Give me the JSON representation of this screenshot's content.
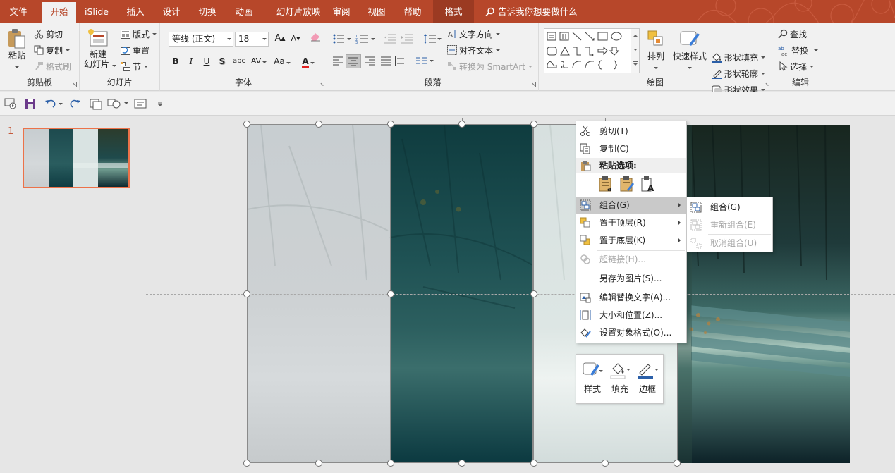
{
  "tabs": [
    {
      "label": "文件"
    },
    {
      "label": "开始"
    },
    {
      "label": "iSlide"
    },
    {
      "label": "插入"
    },
    {
      "label": "设计"
    },
    {
      "label": "切换"
    },
    {
      "label": "动画"
    },
    {
      "label": "幻灯片放映"
    },
    {
      "label": "审阅"
    },
    {
      "label": "视图"
    },
    {
      "label": "帮助"
    },
    {
      "label": "格式"
    }
  ],
  "tell_me": "告诉我你想要做什么",
  "ribbon": {
    "clipboard": {
      "label": "剪贴板",
      "paste": "粘贴",
      "cut": "剪切",
      "copy": "复制",
      "format_painter": "格式刷"
    },
    "slides": {
      "label": "幻灯片",
      "new_slide_line1": "新建",
      "new_slide_line2": "幻灯片",
      "layout": "版式",
      "reset": "重置",
      "section": "节"
    },
    "font": {
      "label": "字体",
      "font_name": "等线 (正文)",
      "font_size": "18",
      "grow": "A",
      "shrink": "A",
      "bold": "B",
      "italic": "I",
      "underline": "U",
      "shadow": "S",
      "strike": "abc",
      "spacing": "AV",
      "case": "Aa",
      "color": "A",
      "color_hex": "#e02020"
    },
    "paragraph": {
      "label": "段落",
      "text_direction": "文字方向",
      "align_text": "对齐文本",
      "smartart": "转换为 SmartArt"
    },
    "drawing": {
      "label": "绘图",
      "arrange": "排列",
      "quick_styles": "快速样式",
      "shape_fill": "形状填充",
      "shape_outline": "形状轮廓",
      "shape_effects": "形状效果"
    },
    "editing": {
      "label": "编辑",
      "find": "查找",
      "replace": "替换",
      "select": "选择"
    }
  },
  "thumbnail": {
    "number": "1"
  },
  "context_menu": {
    "cut": "剪切(T)",
    "copy": "复制(C)",
    "paste_options": "粘贴选项:",
    "group": "组合(G)",
    "bring_front": "置于顶层(R)",
    "send_back": "置于底层(K)",
    "hyperlink": "超链接(H)...",
    "save_as_picture": "另存为图片(S)...",
    "alt_text": "编辑替换文字(A)...",
    "size_position": "大小和位置(Z)...",
    "format_object": "设置对象格式(O)..."
  },
  "group_submenu": {
    "group": "组合(G)",
    "regroup": "重新组合(E)",
    "ungroup": "取消组合(U)"
  },
  "mini_toolbar": {
    "style": "样式",
    "fill": "填充",
    "border": "边框"
  },
  "colors": {
    "accent": "#b7472a",
    "thumb_border": "#ec7249"
  }
}
